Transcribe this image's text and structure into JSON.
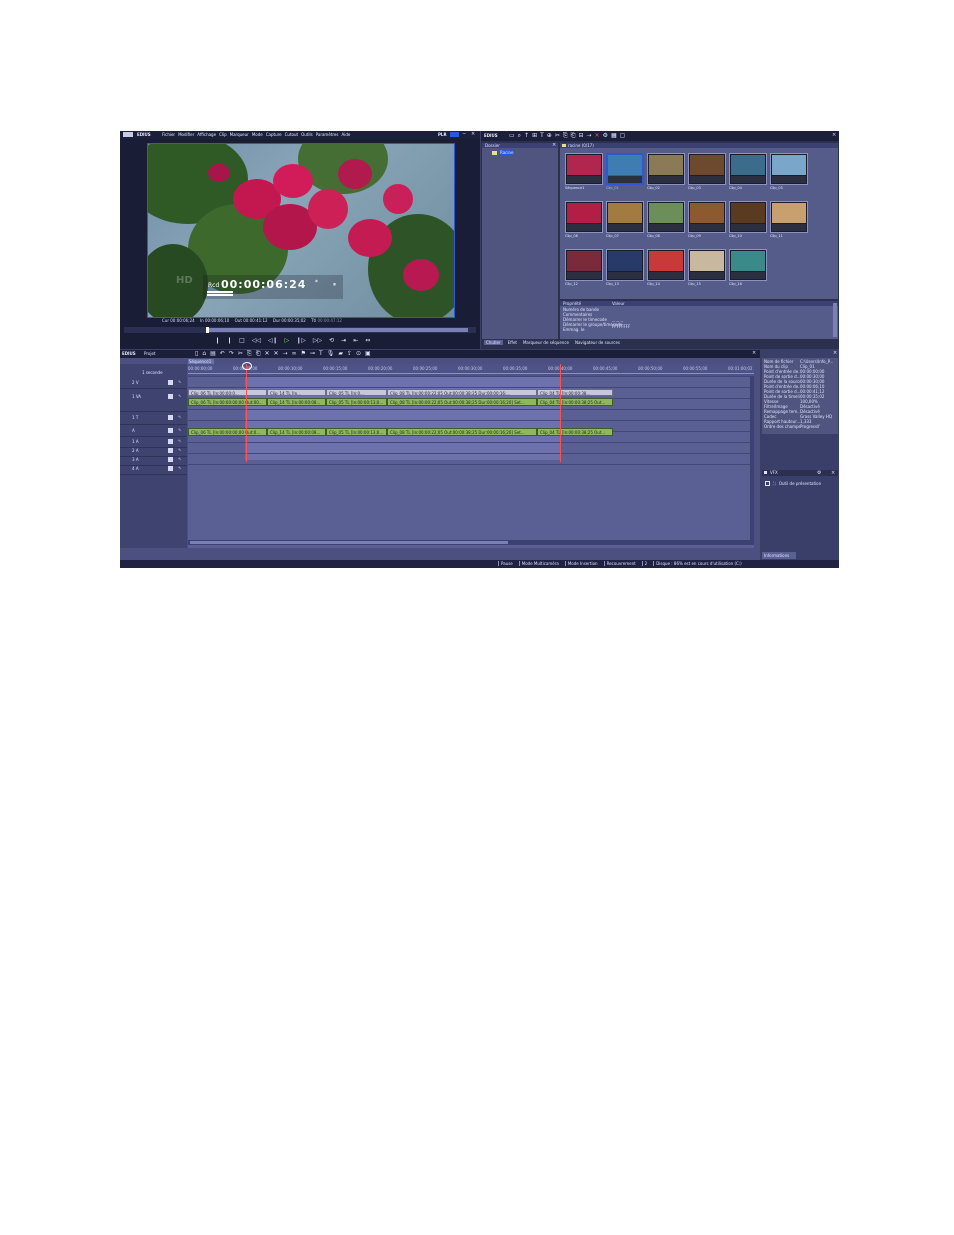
{
  "player": {
    "app_name": "EDIUS",
    "menu": [
      "Fichier",
      "Modifier",
      "Affichage",
      "Clip",
      "Marqueur",
      "Mode",
      "Capture",
      "Cutout",
      "Outils",
      "Paramètres",
      "Aide"
    ],
    "mode_label": "PLR",
    "hd_label": "HD",
    "rec_label": "Rcd",
    "rec_timecode": "00:00:06:24",
    "asterisk": "*",
    "pause_symbol": "⏸",
    "cur_label": "Cur",
    "cur_tc": "00:00:06;24",
    "in_label": "In",
    "in_tc": "00:00:06;10",
    "out_label": "Out",
    "out_tc": "00:00:41:12",
    "dur_label": "Dur",
    "dur_tc": "00:00:35;02",
    "ttl_label": "Ttl",
    "ttl_tc": "00:00:47:12"
  },
  "bin": {
    "app_name": "EDIUS",
    "folder_header": "Dossier",
    "root_folder": "Racine",
    "path_label": "racine (0/17)",
    "clips": [
      {
        "label": "Séquence1"
      },
      {
        "label": "Clip_01"
      },
      {
        "label": "Clip_02"
      },
      {
        "label": "Clip_03"
      },
      {
        "label": "Clip_04"
      },
      {
        "label": "Clip_05"
      },
      {
        "label": "Clip_06"
      },
      {
        "label": "Clip_07"
      },
      {
        "label": "Clip_08"
      },
      {
        "label": "Clip_09"
      },
      {
        "label": "Clip_10"
      },
      {
        "label": "Clip_11"
      },
      {
        "label": "Clip_12"
      },
      {
        "label": "Clip_13"
      },
      {
        "label": "Clip_14"
      },
      {
        "label": "Clip_15"
      },
      {
        "label": "Clip_16"
      }
    ],
    "props_header_left": "Propriété",
    "props_header_right": "Valeur",
    "props_rows": [
      "Numéro de bande",
      "Commentaires",
      "Démarrer le timecode",
      "Démarrer le groupe/timecode",
      "Emmag. le"
    ],
    "props_value_1": "-- -- --",
    "props_value_2": "FFFFFFFF",
    "tabs": [
      "Chutier",
      "Effet",
      "Marqueur de séquence",
      "Navigateur de sources"
    ]
  },
  "timeline": {
    "app_name": "EDIUS",
    "project_label": "Projet",
    "sequence_tab": "Séquence1",
    "scale_label": "1 seconde",
    "ruler": [
      "00:00:00;00",
      "00:00:05;00",
      "00:00:10;00",
      "00:00:15;00",
      "00:00:20;00",
      "00:00:25;00",
      "00:00:30;00",
      "00:00:35;00",
      "00:00:40;00",
      "00:00:45;00",
      "00:00:50;00",
      "00:00:55;00",
      "00:01:00;02"
    ],
    "track_names": [
      "2 V",
      "1 VA",
      "1 T",
      "A",
      "1 A",
      "2 A",
      "3 A",
      "4 A"
    ],
    "video_clips": [
      "Clip_06 TL [In:00:00:00;00 Out:00...",
      "Clip_14 TL [In:00:00:08...",
      "Clip_05 TL [In:00:00:13;0...",
      "Clip_08 TL [In:00:00:22;05 Out:00:00:38;25 Dur:00:00:16;20] Set...",
      "Clip_04 TL [In:00:00:38;25 Out..."
    ],
    "title_clips": [
      "Clip_06 TL [In:00:00:0...",
      "Clip_14 TL [In...",
      "Clip_05 TL [In:0...",
      "Clip_08 TL [In:00:00:22;05 Out:00:00:38;25 Dur:00:00:16;...",
      "Clip_04 TL [In:00:00:38..."
    ],
    "audio_clips": [
      "Clip_06 TL [In:00:00:00;00 Out:0...",
      "Clip_14 TL [In:00:00:08...",
      "Clip_05 TL [In:00:00:13;0...",
      "Clip_08 TL [In:00:00:22;05 Out:00:00:38;25 Dur:00:00:16;20] Set...",
      "Clip_04 TL [In:00:00:38;25 Out..."
    ]
  },
  "info": {
    "rows": [
      {
        "k": "Nom de fichier",
        "v": "C:\\Users\\Info_P..."
      },
      {
        "k": "Nom du clip",
        "v": "Clip_01"
      },
      {
        "k": "Point d'entrée de...",
        "v": "00:00:00;00"
      },
      {
        "k": "Point de sortie d...",
        "v": "00:00:30;00"
      },
      {
        "k": "Durée de la source",
        "v": "00:00:30;00"
      },
      {
        "k": "Point d'entrée de...",
        "v": "00:00:06;10"
      },
      {
        "k": "Point de sortie d...",
        "v": "00:00:41;12"
      },
      {
        "k": "Durée de la timeline",
        "v": "00:00:35;02"
      },
      {
        "k": "Vitesse",
        "v": "100,00%"
      },
      {
        "k": "Filtre/Image",
        "v": "Désactivé"
      },
      {
        "k": "Remappage tem...",
        "v": "Désactivé"
      },
      {
        "k": "Codec",
        "v": "Grass Valley HQ"
      },
      {
        "k": "Rapport hauteur...",
        "v": "1,333"
      },
      {
        "k": "Ordre des champs",
        "v": "Progressif"
      }
    ],
    "vfx_tab": "VFX",
    "vfx_item": "Outil de présentation",
    "bottom_tab": "Informations"
  },
  "status": {
    "items": [
      "Pause",
      "Mode Multicaméra",
      "Mode Insertion",
      "Recouvrement",
      "2",
      "Disque : 86% est en cours d'utilisation (C:)"
    ]
  },
  "colors": {
    "panel": "#3b3f63",
    "video_clip": "#8fb760",
    "title_clip": "#c6c7d9",
    "selection": "#2b57d9",
    "playhead": "#ff5050"
  }
}
